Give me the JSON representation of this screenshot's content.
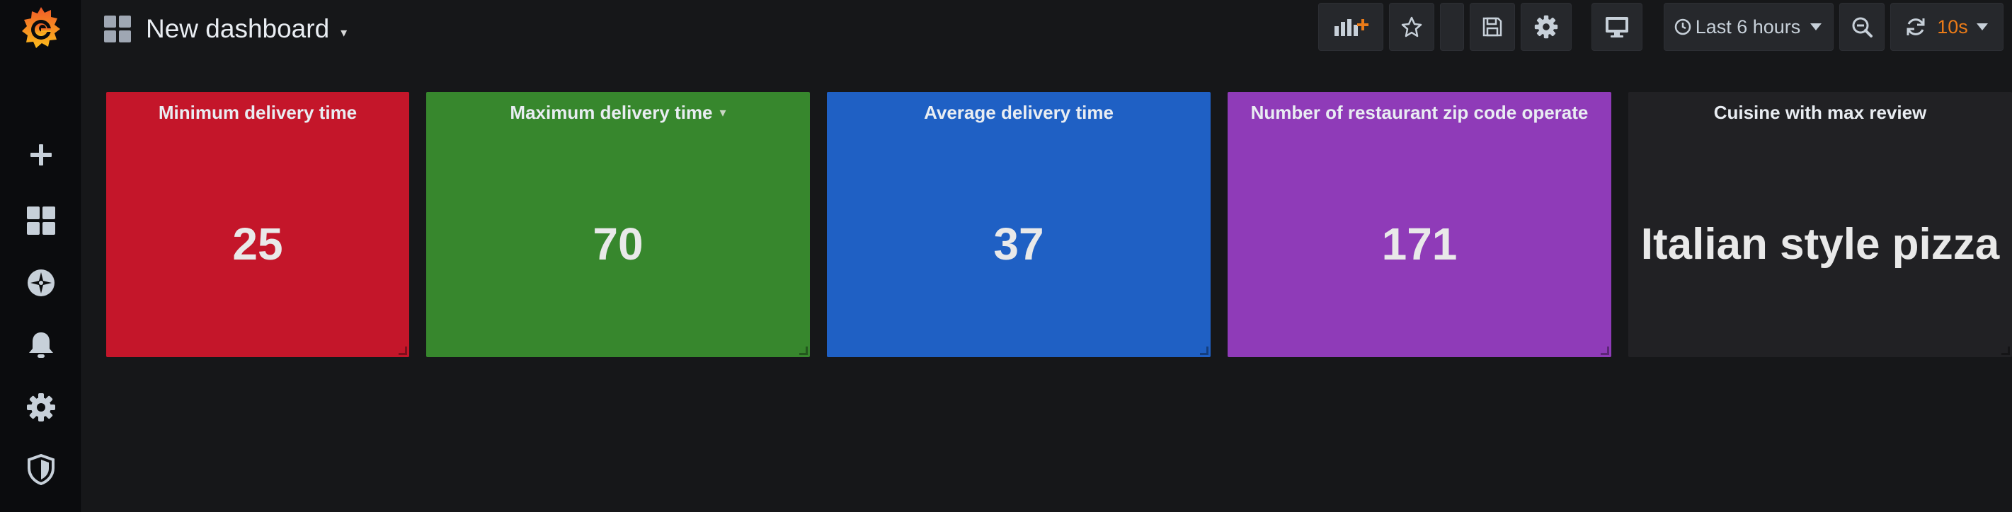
{
  "header": {
    "dashboard_title": "New dashboard",
    "title_caret": "▾",
    "time_range": "Last 6 hours",
    "refresh_interval": "10s"
  },
  "sidebar": {
    "items": [
      {
        "icon": "plus-icon"
      },
      {
        "icon": "dashboards-icon"
      },
      {
        "icon": "explore-icon"
      },
      {
        "icon": "bell-icon"
      },
      {
        "icon": "gear-icon"
      },
      {
        "icon": "shield-icon"
      }
    ]
  },
  "toolbar": {
    "buttons": [
      "add-panel-icon",
      "star-icon",
      "share-icon",
      "save-icon",
      "settings-icon",
      "tv-mode-icon",
      "clock-icon",
      "zoom-out-icon",
      "refresh-icon"
    ]
  },
  "panels": [
    {
      "title": "Minimum delivery time",
      "value": "25",
      "color": "#c4162a"
    },
    {
      "title": "Maximum delivery time",
      "value": "70",
      "color": "#37872d",
      "title_caret": "▾"
    },
    {
      "title": "Average delivery time",
      "value": "37",
      "color": "#1f60c4"
    },
    {
      "title": "Number of restaurant zip code operate",
      "value": "171",
      "color": "#8f3bb8"
    },
    {
      "title": "Cuisine with max review",
      "value": "Italian style pizza",
      "color": "#212124"
    }
  ],
  "colors": {
    "background": "#161719",
    "sidebar": "#0b0c0e",
    "accent_orange": "#eb7b18"
  }
}
